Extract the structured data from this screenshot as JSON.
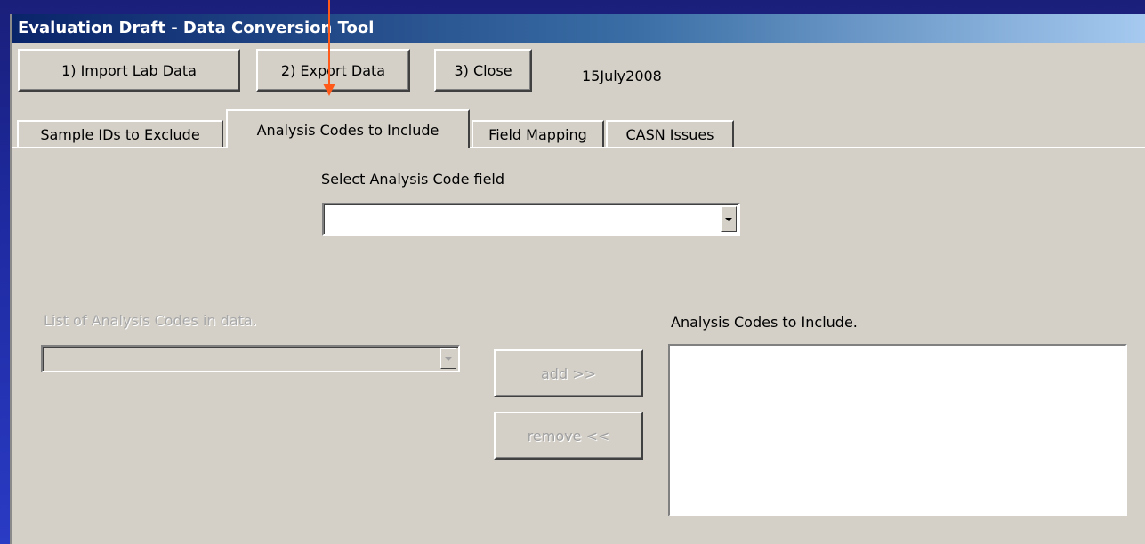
{
  "window": {
    "title": "Evaluation Draft - Data Conversion Tool"
  },
  "toolbar": {
    "import_label": "1) Import Lab Data",
    "export_label": "2) Export Data",
    "close_label": "3) Close",
    "date": "15July2008"
  },
  "tabs": [
    {
      "label": "Sample IDs to Exclude",
      "active": false
    },
    {
      "label": "Analysis Codes to Include",
      "active": true
    },
    {
      "label": "Field Mapping",
      "active": false
    },
    {
      "label": "CASN Issues",
      "active": false
    }
  ],
  "panel": {
    "select_field_label": "Select Analysis Code field",
    "select_field_value": "",
    "list_label": "List of Analysis Codes in data.",
    "list_value": "",
    "include_label": "Analysis Codes to Include.",
    "add_label": "add >>",
    "remove_label": "remove <<",
    "included_items": []
  },
  "annotation": {
    "color": "#ff5a1a"
  }
}
